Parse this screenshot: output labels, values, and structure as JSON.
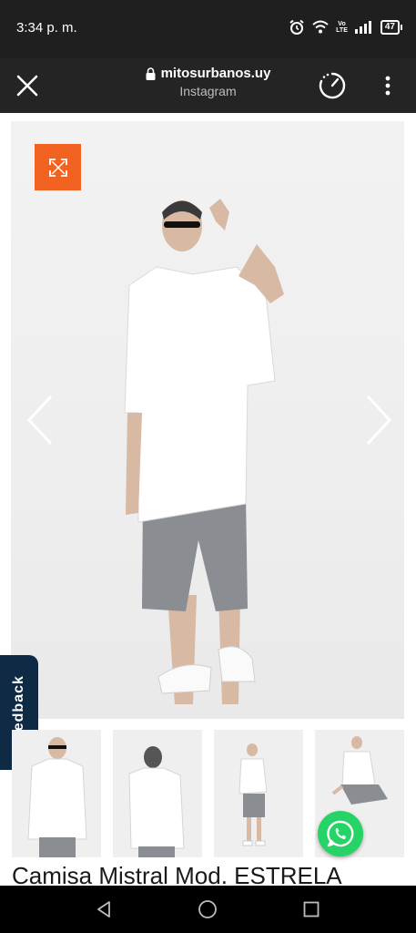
{
  "status_bar": {
    "time": "3:34 p. m.",
    "volte_top": "Vo",
    "volte_bottom": "LTE",
    "battery": "47",
    "icons": [
      "alarm-icon",
      "wifi-icon",
      "volte-icon",
      "signal-icon",
      "battery-icon"
    ]
  },
  "browser": {
    "domain": "mitosurbanos.uy",
    "subtitle": "Instagram",
    "icons": [
      "close-icon",
      "lock-icon",
      "speed-icon",
      "more-vert-icon"
    ]
  },
  "gallery": {
    "accent_color": "#f26322",
    "icons": [
      "expand-icon",
      "chevron-left-icon",
      "chevron-right-icon"
    ]
  },
  "feedback": {
    "label": "Feedback",
    "color": "#0f2a44"
  },
  "thumbnails": [
    "thumb-front",
    "thumb-back",
    "thumb-full",
    "thumb-seated"
  ],
  "whatsapp": {
    "color": "#25d366",
    "icon": "whatsapp-icon"
  },
  "product": {
    "title": "Camisa Mistral Mod. ESTRELA"
  },
  "nav": {
    "icons": [
      "back-icon",
      "home-icon",
      "recents-icon"
    ]
  }
}
